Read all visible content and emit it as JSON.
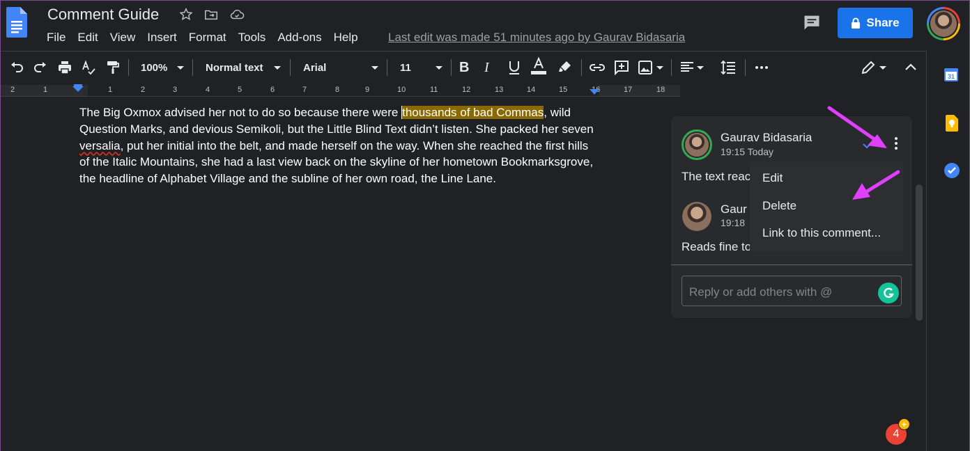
{
  "header": {
    "title": "Comment Guide",
    "menu": [
      "File",
      "Edit",
      "View",
      "Insert",
      "Format",
      "Tools",
      "Add-ons",
      "Help"
    ],
    "last_edit": "Last edit was made 51 minutes ago by Gaurav Bidasaria",
    "share_label": "Share"
  },
  "toolbar": {
    "zoom": "100%",
    "style": "Normal text",
    "font": "Arial",
    "font_size": "11"
  },
  "ruler": {
    "numbers": [
      "2",
      "1",
      "1",
      "2",
      "3",
      "4",
      "5",
      "6",
      "7",
      "8",
      "9",
      "10",
      "11",
      "12",
      "13",
      "14",
      "15",
      "16",
      "17",
      "18"
    ]
  },
  "document": {
    "text_before": "The Big Oxmox advised her not to do so because there were ",
    "highlighted": "thousands of bad Commas",
    "text_mid1": ", wild Question Marks, and devious Semikoli, but the Little Blind Text didn’t listen. She packed her seven ",
    "misspelled": "versalia",
    "text_after": ", put her initial into the belt, and made herself on the way. When she reached the first hills of the Italic Mountains, she had a last view back on the skyline of her hometown Bookmarksgrove, the headline of Alphabet Village and the subline of her own road, the Line Lane."
  },
  "comments": {
    "first": {
      "author": "Gaurav Bidasaria",
      "time": "19:15 Today",
      "text": "The text reac"
    },
    "second": {
      "author": "Gaur",
      "time": "19:18",
      "text": "Reads fine to"
    },
    "reply_placeholder": "Reply or add others with @"
  },
  "context_menu": {
    "items": [
      "Edit",
      "Delete",
      "Link to this comment..."
    ]
  },
  "side_panel": {
    "calendar_day": "31",
    "notification_count": "4",
    "notification_badge": "+"
  },
  "colors": {
    "accent": "#1a73e8",
    "highlight": "#8a6a00",
    "annotation_arrow": "#e040fb"
  }
}
